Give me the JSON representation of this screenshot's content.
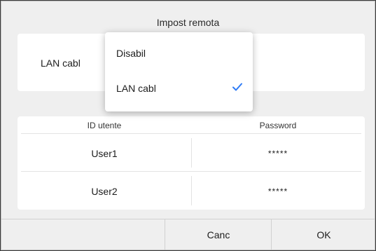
{
  "dialog": {
    "title": "Impost remota",
    "mode_value": "LAN cabl",
    "dropdown": {
      "options": [
        {
          "label": "Disabil",
          "selected": false
        },
        {
          "label": "LAN cabl",
          "selected": true
        }
      ],
      "check_color": "#2f7cf6"
    },
    "table": {
      "headers": [
        "ID utente",
        "Password"
      ],
      "rows": [
        {
          "user": "User1",
          "password": "*****"
        },
        {
          "user": "User2",
          "password": "*****"
        }
      ]
    },
    "footer": {
      "cancel_label": "Canc",
      "ok_label": "OK"
    }
  }
}
